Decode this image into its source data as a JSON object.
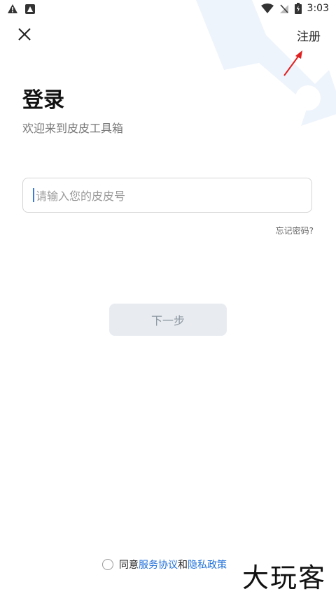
{
  "status_bar": {
    "time": "3:03",
    "icons": [
      "warning-icon",
      "notification-icon",
      "wifi-icon",
      "no-sim-icon",
      "battery-icon"
    ]
  },
  "header": {
    "close_icon": "close-icon",
    "register_label": "注册"
  },
  "login": {
    "title": "登录",
    "subtitle": "欢迎来到皮皮工具箱",
    "input_placeholder": "请输入您的皮皮号",
    "forgot_label": "忘记密码?",
    "next_label": "下一步"
  },
  "agreement": {
    "prefix": "同意",
    "service_link": "服务协议",
    "and": "和",
    "privacy_link": "隐私政策"
  },
  "watermark": "大玩客",
  "colors": {
    "link": "#1e6fd9",
    "button_bg": "#e8ecf0",
    "annotation_arrow": "#e02020",
    "bg_logo": "#eef4fc"
  }
}
